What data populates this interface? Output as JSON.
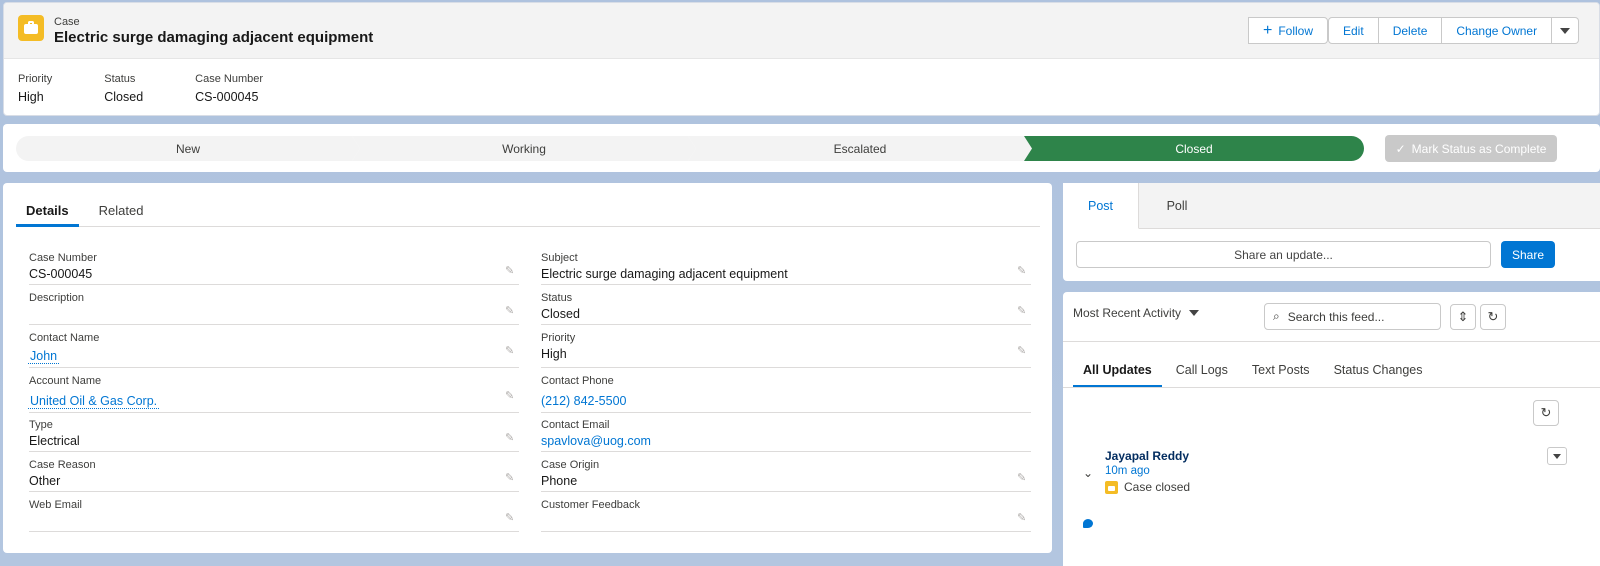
{
  "header": {
    "object_label": "Case",
    "title": "Electric surge damaging adjacent equipment",
    "buttons": {
      "follow": "Follow",
      "edit": "Edit",
      "delete": "Delete",
      "change_owner": "Change Owner"
    },
    "icon": "briefcase-icon",
    "icon_color": "#f4bc25"
  },
  "highlights": [
    {
      "label": "Priority",
      "value": "High"
    },
    {
      "label": "Status",
      "value": "Closed"
    },
    {
      "label": "Case Number",
      "value": "CS-000045"
    }
  ],
  "path": {
    "steps": [
      "New",
      "Working",
      "Escalated",
      "Closed"
    ],
    "current": "Closed",
    "current_color": "#2e844a",
    "mark_complete_label": "Mark Status as Complete"
  },
  "details": {
    "tabs": [
      "Details",
      "Related"
    ],
    "active_tab": "Details",
    "left_fields": [
      {
        "label": "Case Number",
        "value": "CS-000045"
      },
      {
        "label": "Description",
        "value": ""
      },
      {
        "label": "Contact Name",
        "value": "John"
      },
      {
        "label": "Account Name",
        "value": "United Oil & Gas Corp."
      },
      {
        "label": "Type",
        "value": "Electrical"
      },
      {
        "label": "Case Reason",
        "value": "Other"
      },
      {
        "label": "Web Email",
        "value": ""
      }
    ],
    "right_fields": [
      {
        "label": "Subject",
        "value": "Electric surge damaging adjacent equipment"
      },
      {
        "label": "Status",
        "value": "Closed"
      },
      {
        "label": "Priority",
        "value": "High"
      },
      {
        "label": "Contact Phone",
        "value": "(212) 842-5500"
      },
      {
        "label": "Contact Email",
        "value": "spavlova@uog.com"
      },
      {
        "label": "Case Origin",
        "value": "Phone"
      },
      {
        "label": "Customer Feedback",
        "value": ""
      }
    ]
  },
  "chatter": {
    "tabs": [
      "Post",
      "Poll"
    ],
    "active_tab": "Post",
    "share_placeholder": "Share an update...",
    "share_button": "Share"
  },
  "feed": {
    "sort_label": "Most Recent Activity",
    "search_placeholder": "Search this feed...",
    "tabs": [
      "All Updates",
      "Call Logs",
      "Text Posts",
      "Status Changes"
    ],
    "active_tab": "All Updates",
    "post": {
      "author": "Jayapal Reddy",
      "time": "10m ago",
      "body": "Case closed"
    }
  },
  "accent_color": "#0176d3"
}
